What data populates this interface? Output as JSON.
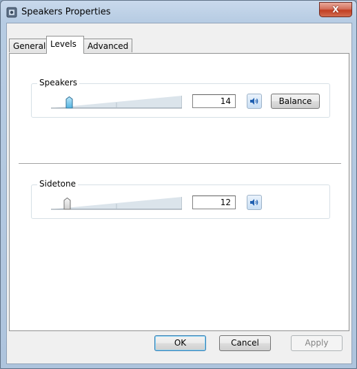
{
  "window": {
    "title": "Speakers Properties",
    "close_label": "X"
  },
  "tabs": [
    {
      "label": "General"
    },
    {
      "label": "Levels"
    },
    {
      "label": "Advanced"
    }
  ],
  "active_tab": "Levels",
  "speakers": {
    "label": "Speakers",
    "value": "14",
    "level": 14,
    "balance_label": "Balance"
  },
  "sidetone": {
    "label": "Sidetone",
    "value": "12",
    "level": 12
  },
  "buttons": {
    "ok": "OK",
    "cancel": "Cancel",
    "apply": "Apply"
  },
  "colors": {
    "accent": "#3c7fb1",
    "speaker_icon": "#1f5fb0",
    "thumb_active": "#6cc3ea"
  }
}
